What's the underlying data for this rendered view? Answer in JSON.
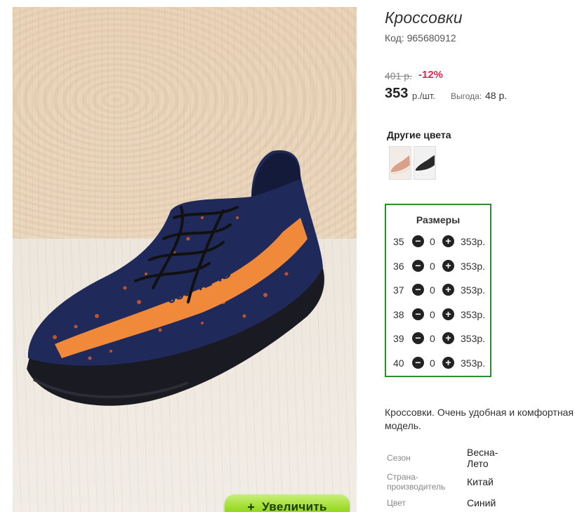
{
  "product": {
    "title": "Кроссовки",
    "code_label": "Код:",
    "code_value": "965680912",
    "old_price": "401 р.",
    "discount": "-12%",
    "price": "353",
    "price_unit": "р./шт.",
    "savings_label": "Выгода:",
    "savings_value": "48 р.",
    "image_icon": "sneaker-photo",
    "shoe_print": "SPLY-350",
    "zoom_button": "Увеличить",
    "zoom_icon": "plus-icon"
  },
  "other_colors": {
    "title": "Другие цвета",
    "swatches": [
      {
        "name": "beige-orange sneaker",
        "color": "#d9a08a"
      },
      {
        "name": "black sneaker",
        "color": "#2a2a2a"
      }
    ]
  },
  "sizes": {
    "title": "Размеры",
    "rows": [
      {
        "size": "35",
        "qty": "0",
        "price": "353р."
      },
      {
        "size": "36",
        "qty": "0",
        "price": "353р."
      },
      {
        "size": "37",
        "qty": "0",
        "price": "353р."
      },
      {
        "size": "38",
        "qty": "0",
        "price": "353р."
      },
      {
        "size": "39",
        "qty": "0",
        "price": "353р."
      },
      {
        "size": "40",
        "qty": "0",
        "price": "353р."
      }
    ]
  },
  "description": "Кроссовки. Очень удобная и комфортная модель.",
  "attributes": [
    {
      "label": "Сезон",
      "value": "Весна-Лето"
    },
    {
      "label": "Страна-производитель",
      "value": "Китай"
    },
    {
      "label": "Цвет",
      "value": "Синий"
    }
  ],
  "colors": {
    "accent_green": "#2e8b2e",
    "discount_red": "#e0284f",
    "zoom_button_green": "#9ddc2a"
  }
}
